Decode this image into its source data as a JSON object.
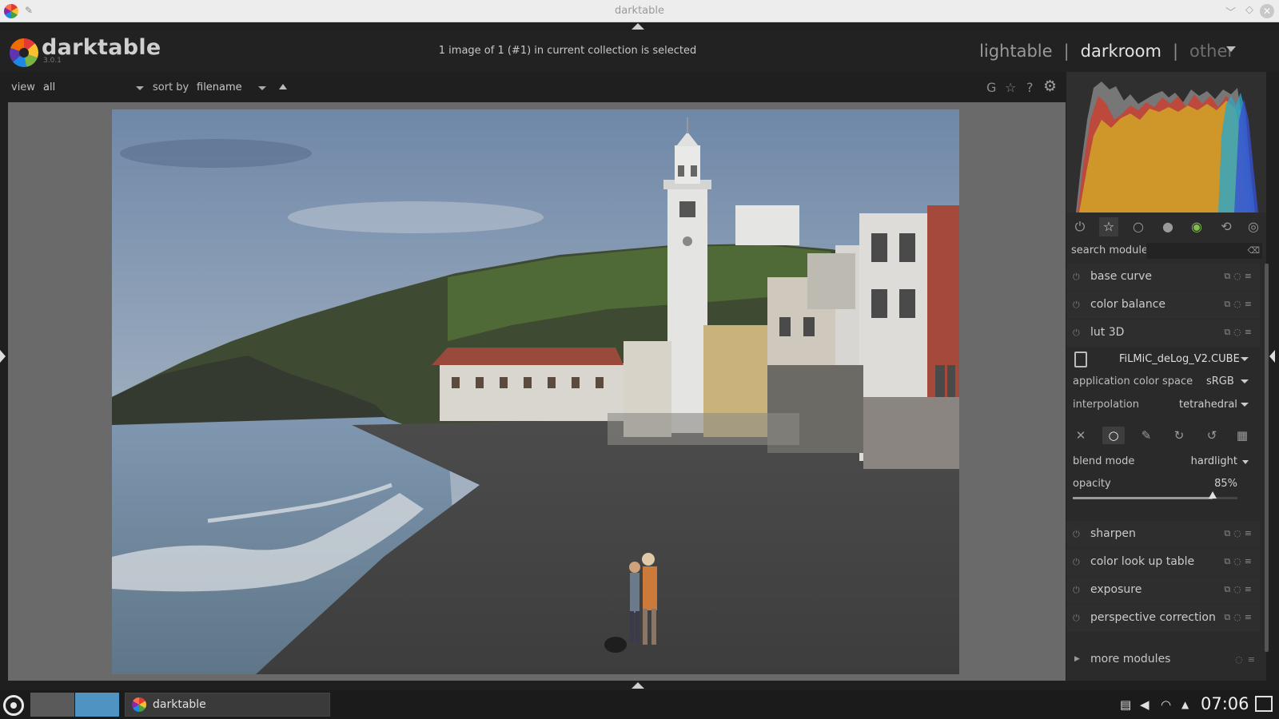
{
  "window": {
    "title": "darktable",
    "controls": {
      "minimize": "﹀",
      "maximize": "◇",
      "close": "✕"
    }
  },
  "header": {
    "logo_text": "darktable",
    "version": "3.0.1",
    "collection_status": "1 image of 1 (#1) in current collection is selected",
    "views": {
      "lighttable": "lightable",
      "separator": "|",
      "darkroom": "darkroom",
      "other": "other"
    }
  },
  "filterbar": {
    "view_label": "view",
    "view_value": "all",
    "sort_label": "sort by",
    "sort_value": "filename"
  },
  "top_tools": {
    "grouping": "G",
    "overlays": "☆",
    "help": "?",
    "preferences": "⚙"
  },
  "module_groups": {
    "items": [
      {
        "name": "active-modules",
        "glyph": "⏻"
      },
      {
        "name": "favorites",
        "glyph": "☆"
      },
      {
        "name": "basic",
        "glyph": "○"
      },
      {
        "name": "tone",
        "glyph": "●"
      },
      {
        "name": "color",
        "glyph": "◉"
      },
      {
        "name": "correct",
        "glyph": "⟲"
      },
      {
        "name": "effect",
        "glyph": "◎"
      }
    ],
    "active_index": 1
  },
  "search": {
    "label": "search module",
    "value": ""
  },
  "modules_top": [
    "base curve",
    "color balance",
    "lut 3D"
  ],
  "lut3d": {
    "file": "FiLMiC_deLog_V2.CUBE",
    "application_color_space_label": "application color space",
    "application_color_space": "sRGB",
    "interpolation_label": "interpolation",
    "interpolation": "tetrahedral",
    "blend_mode_label": "blend mode",
    "blend_mode": "hardlight",
    "opacity_label": "opacity",
    "opacity": "85%",
    "opacity_value": 0.85
  },
  "modules_bottom": [
    "sharpen",
    "color look up table",
    "exposure",
    "perspective correction"
  ],
  "more_modules": "more modules",
  "taskbar": {
    "task_label": "darktable",
    "clock": "07:06"
  },
  "colors": {
    "panel_bg": "#2b2b2b",
    "center_bg": "#6a6a6a",
    "workspace_active": "#4f93c3"
  }
}
